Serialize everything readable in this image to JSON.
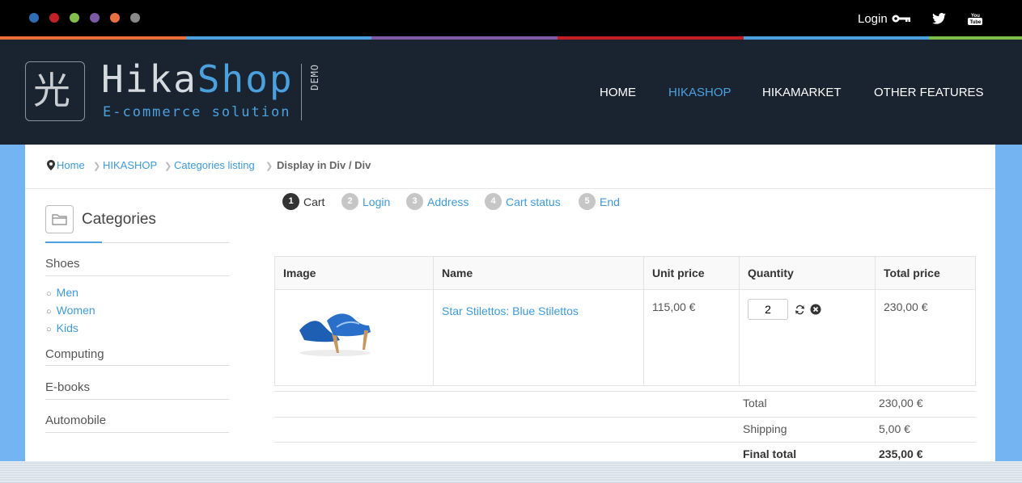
{
  "topbar": {
    "login_label": "Login",
    "dots": [
      "#2f6db5",
      "#c22026",
      "#83c04b",
      "#7d5aa6",
      "#ea7043",
      "#8a8a8a"
    ],
    "color_line": [
      "#e96f36",
      "#4aa0e0",
      "#7f59a7",
      "#c11e24",
      "#4aa0e0",
      "#7cbd45"
    ],
    "youtube_text": "You Tube"
  },
  "header": {
    "logo_glyph": "光",
    "brand_part1": "Hika",
    "brand_part2": "Shop",
    "tagline": "E-commerce solution",
    "demo_label": "DEMO",
    "nav": [
      "HOME",
      "HIKASHOP",
      "HIKAMARKET",
      "OTHER FEATURES"
    ],
    "active_nav": "HIKASHOP"
  },
  "breadcrumb": {
    "items": [
      "Home",
      "HIKASHOP",
      "Categories listing"
    ],
    "current": "Display in Div / Div"
  },
  "sidebar": {
    "title": "Categories",
    "categories": [
      "Shoes",
      "Computing",
      "E-books",
      "Automobile"
    ],
    "subcategories": [
      "Men",
      "Women",
      "Kids"
    ]
  },
  "checkout_steps": [
    {
      "num": "1",
      "label": "Cart"
    },
    {
      "num": "2",
      "label": "Login"
    },
    {
      "num": "3",
      "label": "Address"
    },
    {
      "num": "4",
      "label": "Cart status"
    },
    {
      "num": "5",
      "label": "End"
    }
  ],
  "cart": {
    "headers": [
      "Image",
      "Name",
      "Unit price",
      "Quantity",
      "Total price"
    ],
    "rows": [
      {
        "image": "blue-stiletto-shoe",
        "name": "Star Stilettos: Blue Stilettos",
        "unit_price": "115,00 €",
        "quantity": "2",
        "total_price": "230,00 €"
      }
    ]
  },
  "totals": {
    "total_label": "Total",
    "total_value": "230,00 €",
    "shipping_label": "Shipping",
    "shipping_value": "5,00 €",
    "final_label": "Final total",
    "final_value": "235,00 €"
  },
  "colors": {
    "accent": "#4ba1de",
    "header_bg": "#1a2330",
    "page_bg": "#74b4f2"
  }
}
